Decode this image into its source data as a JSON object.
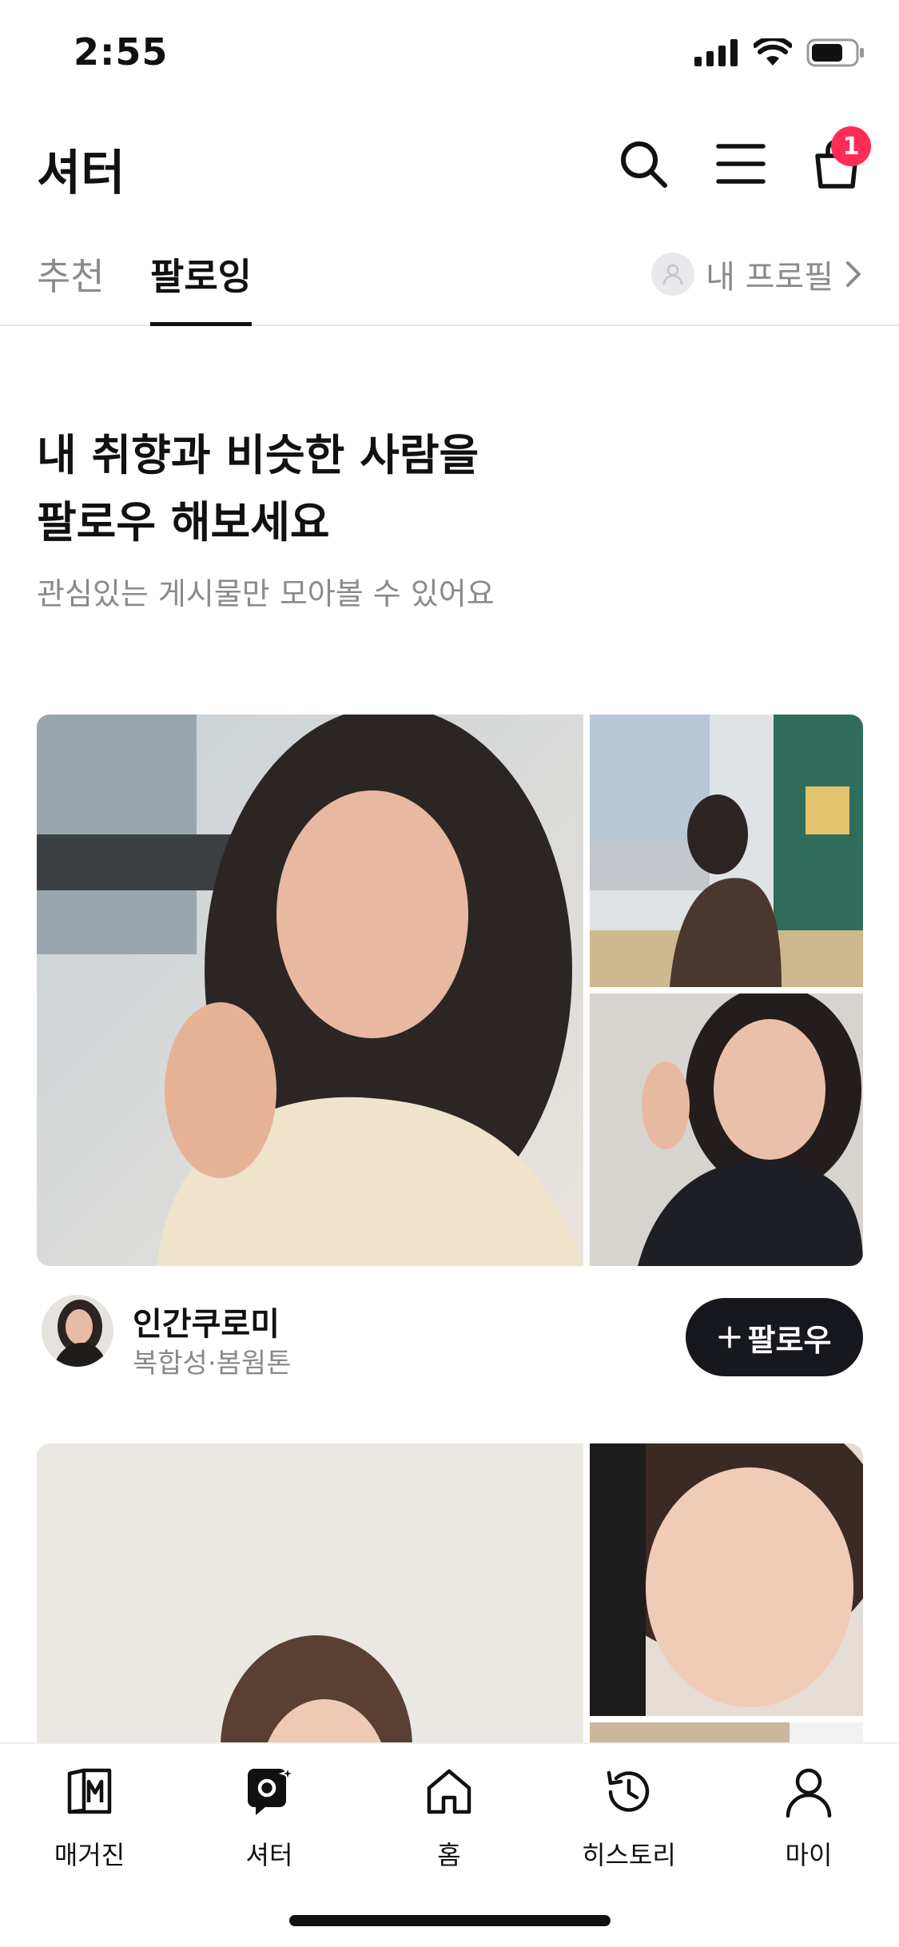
{
  "status_bar": {
    "time": "2:55"
  },
  "header": {
    "title": "셔터",
    "cart_count": "1"
  },
  "tabs": [
    {
      "label": "추천",
      "active": false
    },
    {
      "label": "팔로잉",
      "active": true
    }
  ],
  "profile_link": {
    "label": "내 프로필"
  },
  "hero": {
    "title_line1": "내 취향과 비슷한 사람을",
    "title_line2": "팔로우 해보세요",
    "subtitle": "관심있는 게시물만 모아볼 수 있어요"
  },
  "cards": [
    {
      "user_name": "인간쿠로미",
      "user_tags": "복합성·봄웜톤",
      "follow_label": "팔로우"
    }
  ],
  "bottom_nav": [
    {
      "label": "매거진",
      "icon": "magazine-icon"
    },
    {
      "label": "셔터",
      "icon": "shutter-icon"
    },
    {
      "label": "홈",
      "icon": "home-icon"
    },
    {
      "label": "히스토리",
      "icon": "history-icon"
    },
    {
      "label": "마이",
      "icon": "person-icon"
    }
  ],
  "colors": {
    "badge": "#ff2d55",
    "follow_button": "#16181d",
    "muted_text": "#8a8a8a"
  }
}
